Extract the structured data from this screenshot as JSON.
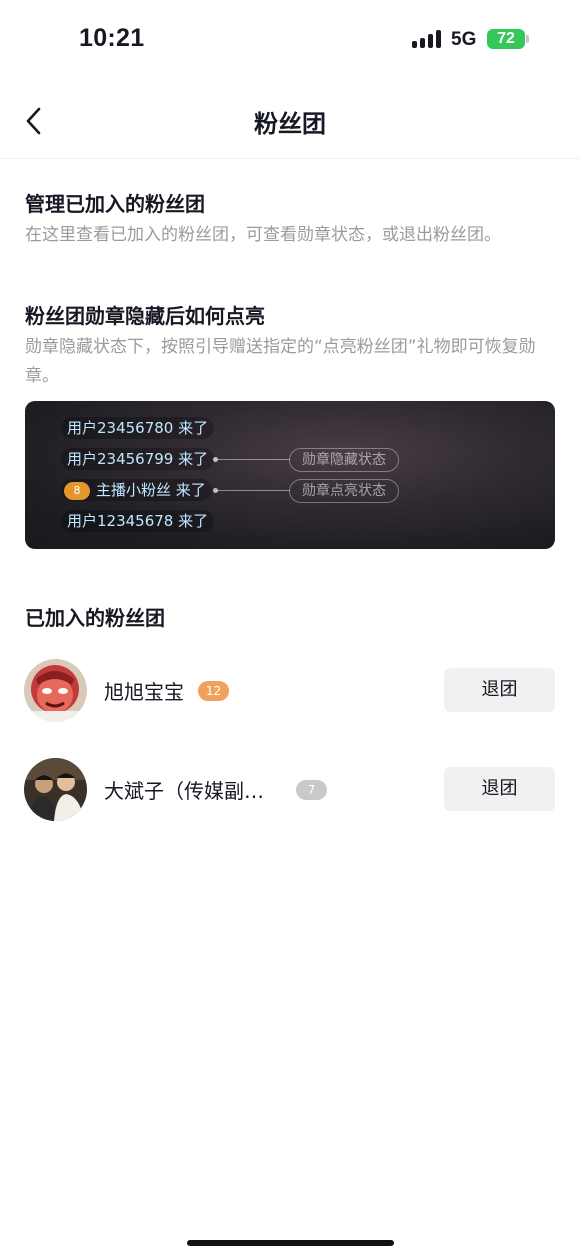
{
  "status": {
    "time": "10:21",
    "network": "5G",
    "battery": "72"
  },
  "nav": {
    "title": "粉丝团"
  },
  "manage": {
    "title": "管理已加入的粉丝团",
    "desc": "在这里查看已加入的粉丝团，可查看勋章状态，或退出粉丝团。"
  },
  "relight": {
    "title": "粉丝团勋章隐藏后如何点亮",
    "desc": "勋章隐藏状态下，按照引导赠送指定的“点亮粉丝团”礼物即可恢复勋章。"
  },
  "demo": {
    "rows": [
      "用户23456780 来了",
      "用户23456799 来了",
      "主播小粉丝 来了",
      "用户12345678 来了"
    ],
    "badge_level": "8",
    "hidden_label": "勋章隐藏状态",
    "lit_label": "勋章点亮状态"
  },
  "joined": {
    "title": "已加入的粉丝团",
    "items": [
      {
        "name": "旭旭宝宝",
        "level": "12",
        "level_color": "#f2a15c",
        "button": "退团"
      },
      {
        "name": "大斌子（传媒副…",
        "level": "7",
        "level_color": "#c9c9cc",
        "button": "退团"
      }
    ]
  }
}
